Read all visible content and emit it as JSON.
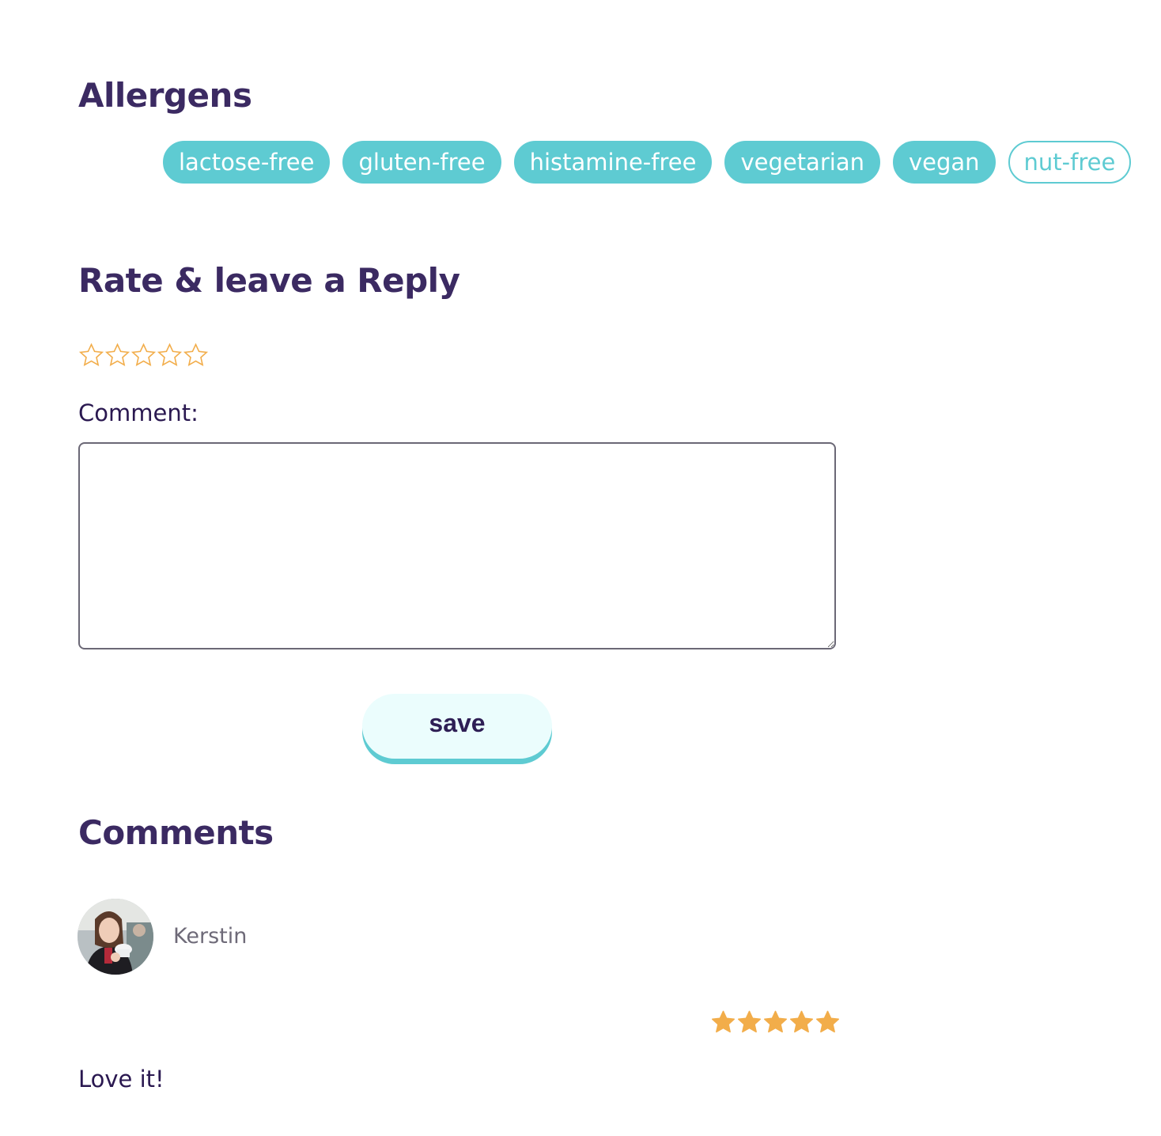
{
  "allergens": {
    "title": "Allergens",
    "tags": [
      {
        "label": "lactose-free",
        "active": true
      },
      {
        "label": "gluten-free",
        "active": true
      },
      {
        "label": "histamine-free",
        "active": true
      },
      {
        "label": "vegetarian",
        "active": true
      },
      {
        "label": "vegan",
        "active": true
      },
      {
        "label": "nut-free",
        "active": false
      }
    ]
  },
  "reply": {
    "title": "Rate & leave a Reply",
    "rating": 0,
    "rating_max": 5,
    "comment_label": "Comment:",
    "comment_value": "",
    "save_label": "save"
  },
  "comments": {
    "title": "Comments",
    "items": [
      {
        "author": "Kerstin",
        "rating": 5,
        "rating_max": 5,
        "text": "Love it!"
      }
    ]
  },
  "colors": {
    "accent": "#5ecbd2",
    "heading": "#3b2a62",
    "star": "#f2ad4a"
  }
}
